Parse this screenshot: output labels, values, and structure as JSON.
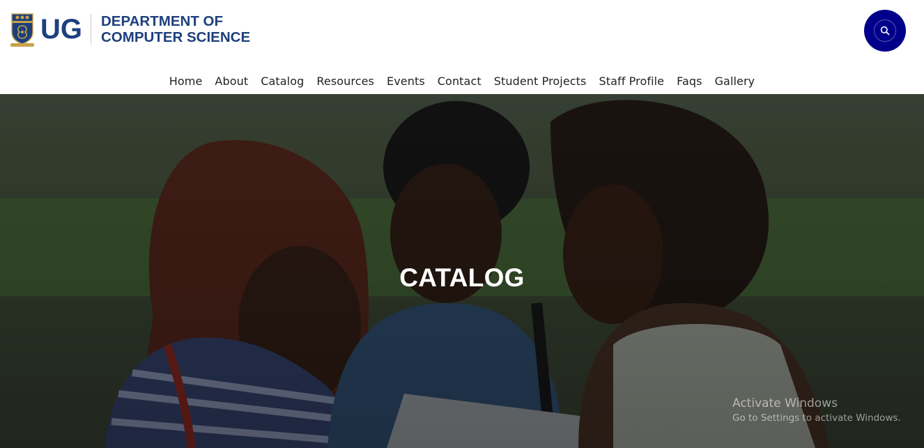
{
  "header": {
    "logo_abbr": "UG",
    "dept_line1": "DEPARTMENT OF",
    "dept_line2": "COMPUTER SCIENCE",
    "search_icon": "search-icon"
  },
  "nav": {
    "items": [
      "Home",
      "About",
      "Catalog",
      "Resources",
      "Events",
      "Contact",
      "Student Projects",
      "Staff Profile",
      "Faqs",
      "Gallery"
    ]
  },
  "hero": {
    "title": "CATALOG"
  },
  "watermark": {
    "title": "Activate Windows",
    "subtitle": "Go to Settings to activate Windows."
  },
  "colors": {
    "brand_blue": "#1d3f7e",
    "search_button": "#00008b",
    "nav_text": "#222222"
  }
}
